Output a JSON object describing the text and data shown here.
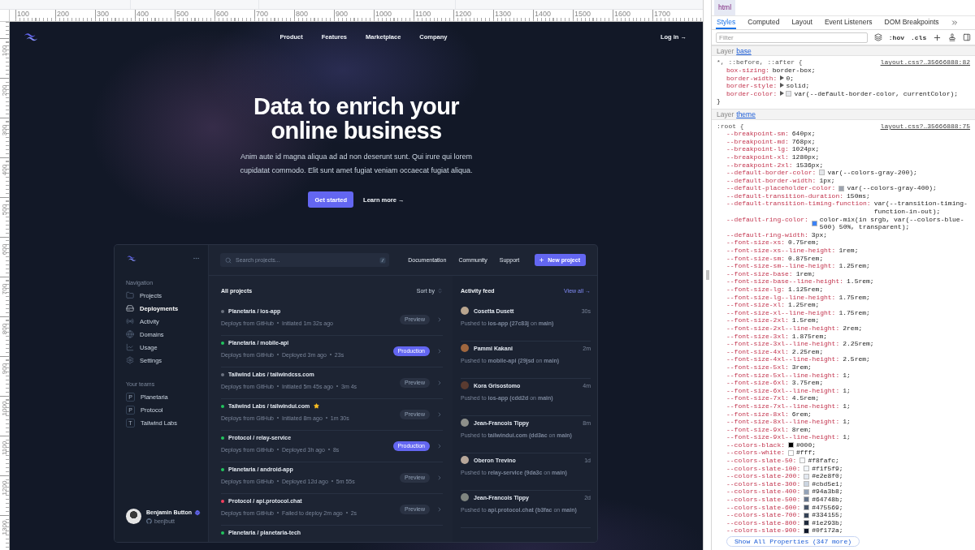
{
  "rulers": {
    "horizontal": [
      "100",
      "200",
      "300",
      "400",
      "500",
      "600",
      "700",
      "800",
      "900",
      "1000",
      "1100",
      "1200",
      "1300",
      "1400",
      "1500",
      "1600",
      "1700"
    ],
    "vertical": [
      "100",
      "200",
      "300",
      "400",
      "500",
      "600",
      "700",
      "800",
      "900",
      "1000",
      "1100",
      "1200",
      "1300"
    ]
  },
  "page": {
    "nav": {
      "links": [
        "Product",
        "Features",
        "Marketplace",
        "Company"
      ],
      "login": "Log in →"
    },
    "hero": {
      "title": "Data to enrich your online business",
      "text": "Anim aute id magna aliqua ad ad non deserunt sunt. Qui irure qui lorem cupidatat commodo. Elit sunt amet fugiat veniam occaecat fugiat aliqua.",
      "primary": "Get started",
      "secondary": "Learn more →"
    },
    "dashboard": {
      "sidebar": {
        "nav_heading": "Navigation",
        "nav_items": [
          {
            "label": "Projects",
            "selected": false
          },
          {
            "label": "Deployments",
            "selected": true
          },
          {
            "label": "Activity",
            "selected": false
          },
          {
            "label": "Domains",
            "selected": false
          },
          {
            "label": "Usage",
            "selected": false
          },
          {
            "label": "Settings",
            "selected": false
          }
        ],
        "teams_heading": "Your teams",
        "teams": [
          {
            "initial": "P",
            "name": "Planetaria"
          },
          {
            "initial": "P",
            "name": "Protocol"
          },
          {
            "initial": "T",
            "name": "Tailwind Labs"
          }
        ],
        "user": {
          "name": "Benjamin Button",
          "handle": "benjbutt",
          "verified": true
        }
      },
      "topbar": {
        "search_placeholder": "Search projects...",
        "links": [
          "Documentation",
          "Community",
          "Support"
        ],
        "new_project": "New project"
      },
      "projects": {
        "heading": "All projects",
        "sort": "Sort by",
        "rows": [
          {
            "title": "Planetaria / ios-app",
            "color": "#6b7280",
            "starred": false,
            "meta": [
              "Deploys from GitHub",
              "Initiated 1m 32s ago"
            ],
            "badge": "Preview",
            "kind": "preview"
          },
          {
            "title": "Planetaria / mobile-api",
            "color": "#22c55e",
            "starred": false,
            "meta": [
              "Deploys from GitHub",
              "Deployed 3m ago",
              "23s"
            ],
            "badge": "Production",
            "kind": "production"
          },
          {
            "title": "Tailwind Labs / tailwindcss.com",
            "color": "#6b7280",
            "starred": false,
            "meta": [
              "Deploys from GitHub",
              "Initiated 5m 45s ago",
              "3m 4s"
            ],
            "badge": "Preview",
            "kind": "preview"
          },
          {
            "title": "Tailwind Labs / tailwindui.com",
            "color": "#22c55e",
            "starred": true,
            "meta": [
              "Deploys from GitHub",
              "Initiated 8m ago",
              "1m 30s"
            ],
            "badge": "Preview",
            "kind": "preview"
          },
          {
            "title": "Protocol / relay-service",
            "color": "#22c55e",
            "starred": false,
            "meta": [
              "Deploys from GitHub",
              "Deployed 3h ago",
              "8s"
            ],
            "badge": "Production",
            "kind": "production"
          },
          {
            "title": "Planetaria / android-app",
            "color": "#22c55e",
            "starred": false,
            "meta": [
              "Deploys from GitHub",
              "Deployed 12d ago",
              "5m 55s"
            ],
            "badge": "Preview",
            "kind": "preview"
          },
          {
            "title": "Protocol / api.protocol.chat",
            "color": "#f43f5e",
            "starred": false,
            "meta": [
              "Deploys from GitHub",
              "Failed to deploy 2m ago",
              "2s"
            ],
            "badge": "Preview",
            "kind": "preview"
          },
          {
            "title": "Planetaria / planetaria-tech",
            "color": "#22c55e",
            "starred": false
          }
        ]
      },
      "feed": {
        "heading": "Activity feed",
        "view_all": "View all →",
        "items": [
          {
            "name": "Cosetta Dusett",
            "time": "30s",
            "text": "Pushed to **ios-app (27c83j** on **main)**"
          },
          {
            "name": "Pammi Kakani",
            "time": "2m",
            "text": "Pushed to **mobile-api (29jsd** on **main)**"
          },
          {
            "name": "Kora Grisostomo",
            "time": "4m",
            "text": "Pushed to **ios-app (cdd2d** on **main)**"
          },
          {
            "name": "Jean-Francois Tippy",
            "time": "8m",
            "text": "Pushed to **tailwindui.com (dd3ac** on **main)**"
          },
          {
            "name": "Oberon Trevino",
            "time": "1d",
            "text": "Pushed to **relay-service (9da3c** on **main)**"
          },
          {
            "name": "Jean-Francois Tippy",
            "time": "2d",
            "text": "Pushed to **api.protocol.chat (b3fac** on **main)**"
          }
        ]
      }
    }
  },
  "devtools": {
    "breadcrumb": "html",
    "tabs": [
      {
        "label": "Styles",
        "selected": true
      },
      {
        "label": "Computed",
        "selected": false
      },
      {
        "label": "Layout",
        "selected": false
      },
      {
        "label": "Event Listeners",
        "selected": false
      },
      {
        "label": "DOM Breakpoints",
        "selected": false
      }
    ],
    "filter_placeholder": "Filter",
    "toggles": [
      ":hov",
      ".cls"
    ],
    "sections": [
      {
        "label": "Layer",
        "layer": "base",
        "selector": "*, ::before, ::after {",
        "source": "layout.css?…35666888:82",
        "close": "}",
        "declarations": [
          {
            "name": "box-sizing:",
            "value": "border-box;"
          },
          {
            "name": "border-width:",
            "value": "0;",
            "expandable": true
          },
          {
            "name": "border-style:",
            "value": "solid;",
            "expandable": true
          },
          {
            "name": "border-color:",
            "value": "var(--default-border-color, currentColor);",
            "expandable": true,
            "color": "#e5e7eb"
          }
        ]
      },
      {
        "label": "Layer",
        "layer": "theme",
        "selector": ":root {",
        "source": "layout.css?…35666888:75",
        "show_all": "Show All Properties (347 more)",
        "declarations": [
          {
            "name": "--breakpoint-sm:",
            "value": "640px;"
          },
          {
            "name": "--breakpoint-md:",
            "value": "768px;"
          },
          {
            "name": "--breakpoint-lg:",
            "value": "1024px;"
          },
          {
            "name": "--breakpoint-xl:",
            "value": "1280px;"
          },
          {
            "name": "--breakpoint-2xl:",
            "value": "1536px;"
          },
          {
            "name": "--default-border-color:",
            "value": "var(--colors-gray-200);",
            "color": "#e5e7eb"
          },
          {
            "name": "--default-border-width:",
            "value": "1px;"
          },
          {
            "name": "--default-placeholder-color:",
            "value": "var(--colors-gray-400);",
            "color": "#9ca3af"
          },
          {
            "name": "--default-transition-duration:",
            "value": "150ms;"
          },
          {
            "name": "--default-transition-timing-function:",
            "value": "var(--transition-timing-function-in-out);"
          },
          {
            "name": "--default-ring-color:",
            "value": "color-mix(in srgb, var(--colors-blue-500) 50%, transparent);",
            "color": "#3b82f6"
          },
          {
            "name": "--default-ring-width:",
            "value": "3px;"
          },
          {
            "name": "--font-size-xs:",
            "value": "0.75rem;"
          },
          {
            "name": "--font-size-xs--line-height:",
            "value": "1rem;"
          },
          {
            "name": "--font-size-sm:",
            "value": "0.875rem;"
          },
          {
            "name": "--font-size-sm--line-height:",
            "value": "1.25rem;"
          },
          {
            "name": "--font-size-base:",
            "value": "1rem;"
          },
          {
            "name": "--font-size-base--line-height:",
            "value": "1.5rem;"
          },
          {
            "name": "--font-size-lg:",
            "value": "1.125rem;"
          },
          {
            "name": "--font-size-lg--line-height:",
            "value": "1.75rem;"
          },
          {
            "name": "--font-size-xl:",
            "value": "1.25rem;"
          },
          {
            "name": "--font-size-xl--line-height:",
            "value": "1.75rem;"
          },
          {
            "name": "--font-size-2xl:",
            "value": "1.5rem;"
          },
          {
            "name": "--font-size-2xl--line-height:",
            "value": "2rem;"
          },
          {
            "name": "--font-size-3xl:",
            "value": "1.875rem;"
          },
          {
            "name": "--font-size-3xl--line-height:",
            "value": "2.25rem;"
          },
          {
            "name": "--font-size-4xl:",
            "value": "2.25rem;"
          },
          {
            "name": "--font-size-4xl--line-height:",
            "value": "2.5rem;"
          },
          {
            "name": "--font-size-5xl:",
            "value": "3rem;"
          },
          {
            "name": "--font-size-5xl--line-height:",
            "value": "1;"
          },
          {
            "name": "--font-size-6xl:",
            "value": "3.75rem;"
          },
          {
            "name": "--font-size-6xl--line-height:",
            "value": "1;"
          },
          {
            "name": "--font-size-7xl:",
            "value": "4.5rem;"
          },
          {
            "name": "--font-size-7xl--line-height:",
            "value": "1;"
          },
          {
            "name": "--font-size-8xl:",
            "value": "6rem;"
          },
          {
            "name": "--font-size-8xl--line-height:",
            "value": "1;"
          },
          {
            "name": "--font-size-9xl:",
            "value": "8rem;"
          },
          {
            "name": "--font-size-9xl--line-height:",
            "value": "1;"
          },
          {
            "name": "--colors-black:",
            "value": "#000;",
            "color": "#000000"
          },
          {
            "name": "--colors-white:",
            "value": "#fff;",
            "color": "#ffffff"
          },
          {
            "name": "--colors-slate-50:",
            "value": "#f8fafc;",
            "color": "#f8fafc"
          },
          {
            "name": "--colors-slate-100:",
            "value": "#f1f5f9;",
            "color": "#f1f5f9"
          },
          {
            "name": "--colors-slate-200:",
            "value": "#e2e8f0;",
            "color": "#e2e8f0"
          },
          {
            "name": "--colors-slate-300:",
            "value": "#cbd5e1;",
            "color": "#cbd5e1"
          },
          {
            "name": "--colors-slate-400:",
            "value": "#94a3b8;",
            "color": "#94a3b8"
          },
          {
            "name": "--colors-slate-500:",
            "value": "#64748b;",
            "color": "#64748b"
          },
          {
            "name": "--colors-slate-600:",
            "value": "#475569;",
            "color": "#475569"
          },
          {
            "name": "--colors-slate-700:",
            "value": "#334155;",
            "color": "#334155"
          },
          {
            "name": "--colors-slate-800:",
            "value": "#1e293b;",
            "color": "#1e293b"
          },
          {
            "name": "--colors-slate-900:",
            "value": "#0f172a;",
            "color": "#0f172a"
          }
        ]
      }
    ]
  }
}
